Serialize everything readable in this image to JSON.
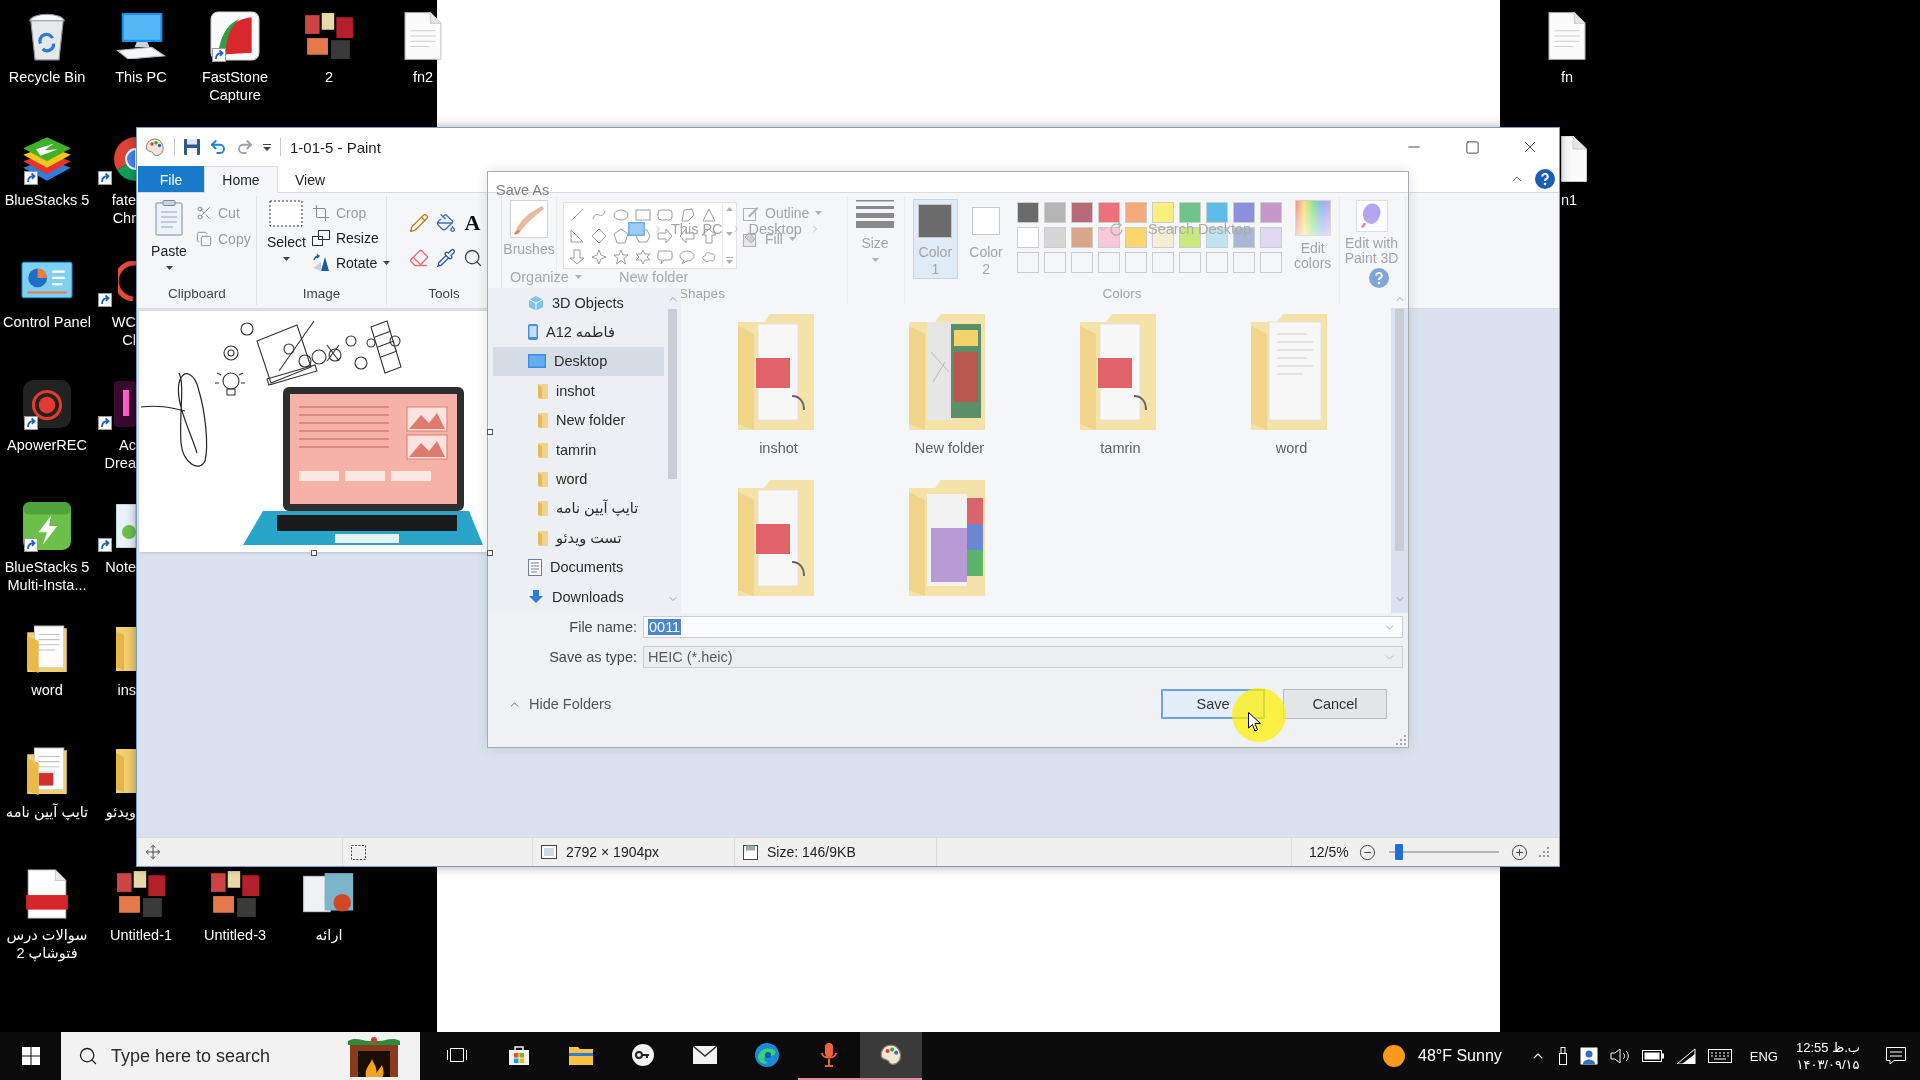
{
  "desktop": {
    "left_column": [
      {
        "label": "Recycle Bin",
        "kind": "recycle",
        "shortcut": false
      },
      {
        "label": "BlueStacks 5",
        "kind": "bluestacks",
        "shortcut": true
      },
      {
        "label": "Control Panel",
        "kind": "control",
        "shortcut": false
      },
      {
        "label": "ApowerREC",
        "kind": "recorder",
        "shortcut": true
      },
      {
        "label": "BlueStacks 5 Multi-Insta...",
        "kind": "multi",
        "shortcut": true
      },
      {
        "label": "word",
        "kind": "folder",
        "shortcut": false
      },
      {
        "label": "تایپ آیین نامه",
        "kind": "pdffolder",
        "shortcut": false
      },
      {
        "label": "سوالات درس فتوشاپ 2",
        "kind": "pdf",
        "shortcut": false
      }
    ],
    "top_row": [
      {
        "label": "This PC",
        "kind": "computer",
        "shortcut": false
      },
      {
        "label": "FastStone Capture",
        "kind": "faststone",
        "shortcut": true
      },
      {
        "label": "2",
        "kind": "photos",
        "shortcut": false
      },
      {
        "label": "fn2",
        "kind": "document",
        "shortcut": false
      }
    ],
    "partly_hidden_column": [
      {
        "lines": [
          "fate",
          "Chr"
        ],
        "kind": "chrome",
        "shortcut": true
      },
      {
        "lines": [
          "WC",
          "Cl"
        ],
        "kind": "webcam",
        "shortcut": true
      },
      {
        "lines": [
          "Ac",
          "Drea"
        ],
        "kind": "dream",
        "shortcut": true
      },
      {
        "lines": [
          "Note"
        ],
        "kind": "notepad",
        "shortcut": true
      },
      {
        "lines": [
          "ins"
        ],
        "kind": "folder",
        "shortcut": false
      },
      {
        "lines": [
          "ویدئو"
        ],
        "kind": "folder",
        "shortcut": false
      }
    ],
    "bottom_row": [
      {
        "label": "Untitled-1",
        "kind": "photos",
        "shortcut": false
      },
      {
        "label": "Untitled-3",
        "kind": "photos",
        "shortcut": false
      },
      {
        "label": "ارائه",
        "kind": "slides",
        "shortcut": false
      }
    ],
    "right_column": [
      {
        "label": "fn",
        "kind": "document",
        "shortcut": false
      }
    ],
    "right_partly_hidden": [
      {
        "lines": [
          "n1"
        ],
        "kind": "document",
        "shortcut": false
      }
    ]
  },
  "paint": {
    "title": "1-01-5 - Paint",
    "tabs": [
      {
        "label": "File",
        "kind": "menu",
        "selected": false
      },
      {
        "label": "Home",
        "kind": "tab",
        "selected": true
      },
      {
        "label": "View",
        "kind": "tab",
        "selected": false
      }
    ],
    "clipboard": {
      "label": "Clipboard",
      "paste": "Paste",
      "actions": [
        {
          "label": "Cut",
          "disabled": true
        },
        {
          "label": "Copy",
          "disabled": true
        }
      ]
    },
    "image": {
      "label": "Image",
      "select": "Select",
      "actions": [
        {
          "label": "Crop",
          "disabled": true
        },
        {
          "label": "Resize",
          "disabled": false
        },
        {
          "label": "Rotate",
          "disabled": false
        }
      ]
    },
    "tools": {
      "label": "Tools",
      "text_tool": "A"
    },
    "brushes": "Brushes",
    "shapes": {
      "label": "Shapes",
      "outline": "Outline",
      "fill": "Fill"
    },
    "size": "Size",
    "colors": {
      "label": "Colors",
      "slots": [
        {
          "label": "Color 1",
          "color": "#6b6b6b",
          "selected": true
        },
        {
          "label": "Color 2",
          "color": "#ffffff",
          "selected": false
        }
      ],
      "palette": [
        {
          "color": "#6b6b6b"
        },
        {
          "color": "#b5b5b5"
        },
        {
          "color": "#b86a78"
        },
        {
          "color": "#ee7179"
        },
        {
          "color": "#f6a97b"
        },
        {
          "color": "#f8f07b"
        },
        {
          "color": "#6fc38b"
        },
        {
          "color": "#5cbde9"
        },
        {
          "color": "#8c90df"
        },
        {
          "color": "#c897c9"
        },
        {
          "color": "#ffffff"
        },
        {
          "color": "#d6d6d6"
        },
        {
          "color": "#d8a78c"
        },
        {
          "color": "#fbc7d8"
        },
        {
          "color": "#fcd56b"
        },
        {
          "color": "#f4efd2"
        },
        {
          "color": "#cbe87c"
        },
        {
          "color": "#bfe3ef"
        },
        {
          "color": "#a6b8d3"
        },
        {
          "color": "#ded8f0"
        }
      ],
      "edit": "Edit colors"
    },
    "paint_3d": "Edit with Paint 3D",
    "status_bar": {
      "dimensions": "2792 × 1904px",
      "file_size": "Size: 146/9KB",
      "zoom": "12/5%",
      "zoom_slider": {
        "level": 0.09
      }
    }
  },
  "save_as": {
    "title": "Save As",
    "path": [
      "This PC",
      "Desktop"
    ],
    "search": {
      "placeholder": "Search Desktop"
    },
    "organize": "Organize",
    "new_folder": "New folder",
    "nav": [
      {
        "label": "3D Objects",
        "kind": "cube",
        "selected": false
      },
      {
        "label": "A12 فاطمه",
        "kind": "phone",
        "selected": false
      },
      {
        "label": "Desktop",
        "kind": "desktop",
        "selected": true,
        "children": [
          {
            "label": "inshot",
            "kind": "folder",
            "selected": false
          },
          {
            "label": "New folder",
            "kind": "folder",
            "selected": false
          },
          {
            "label": "tamrin",
            "kind": "folder",
            "selected": false
          },
          {
            "label": "word",
            "kind": "folder",
            "selected": false
          },
          {
            "label": "تایپ آیین نامه",
            "kind": "folder",
            "selected": false
          },
          {
            "label": "تست ویدئو",
            "kind": "folder",
            "selected": false
          }
        ]
      },
      {
        "label": "Documents",
        "kind": "documents",
        "selected": false
      },
      {
        "label": "Downloads",
        "kind": "downloads",
        "selected": false
      }
    ],
    "files": [
      {
        "label": "inshot",
        "kind": "pdf"
      },
      {
        "label": "New folder",
        "kind": "poster"
      },
      {
        "label": "tamrin",
        "kind": "pdf"
      },
      {
        "label": "word",
        "kind": "papers"
      },
      {
        "kind": "pdf"
      },
      {
        "kind": "gallery"
      }
    ],
    "file_name": {
      "label": "File name:",
      "value": "0011",
      "value_selected": true
    },
    "file_type": {
      "label": "Save as type:",
      "value": "HEIC (*.heic)"
    },
    "hide_folders": "Hide Folders",
    "buttons": [
      {
        "label": "Save",
        "focused": true
      },
      {
        "label": "Cancel",
        "focused": false
      }
    ]
  },
  "taskbar": {
    "search": {
      "placeholder": "Type here to search"
    },
    "apps": [
      {
        "kind": "taskview",
        "running": false,
        "active": false
      },
      {
        "kind": "store",
        "running": false,
        "active": false
      },
      {
        "kind": "explorer",
        "running": false,
        "active": false
      },
      {
        "kind": "key",
        "running": false,
        "active": false
      },
      {
        "kind": "mail",
        "running": false,
        "active": false
      },
      {
        "kind": "edge",
        "running": false,
        "active": false
      },
      {
        "kind": "mic",
        "running": true,
        "active": false
      },
      {
        "kind": "paint",
        "running": true,
        "active": true
      }
    ],
    "weather": "48°F Sunny",
    "language": "ENG",
    "time": "12:55 ب.ظ",
    "date": "۱۴۰۳/۰۹/۱۵"
  }
}
